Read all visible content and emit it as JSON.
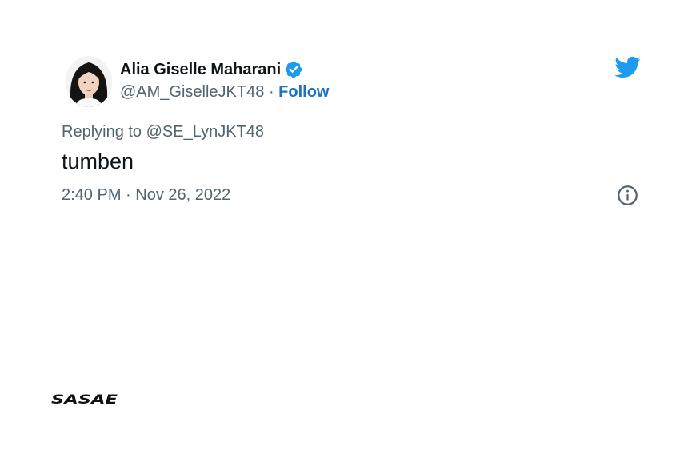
{
  "tweet": {
    "author": {
      "display_name": "Alia Giselle Maharani",
      "handle": "@AM_GiselleJKT48",
      "separator": "·",
      "follow_label": "Follow",
      "verified": true
    },
    "reply_prefix": "Replying to",
    "reply_to_handle": "@SE_LynJKT48",
    "text": "tumben",
    "timestamp": "2:40 PM · Nov 26, 2022"
  },
  "watermark": {
    "brand": "SASAE"
  },
  "icons": {
    "verified": "verified-badge-icon",
    "twitter": "twitter-bird-icon",
    "info": "info-circle-icon"
  },
  "colors": {
    "primary_text": "#0f1419",
    "secondary_text": "#536471",
    "link": "#1d73be",
    "twitter_blue": "#1d9bf0"
  }
}
